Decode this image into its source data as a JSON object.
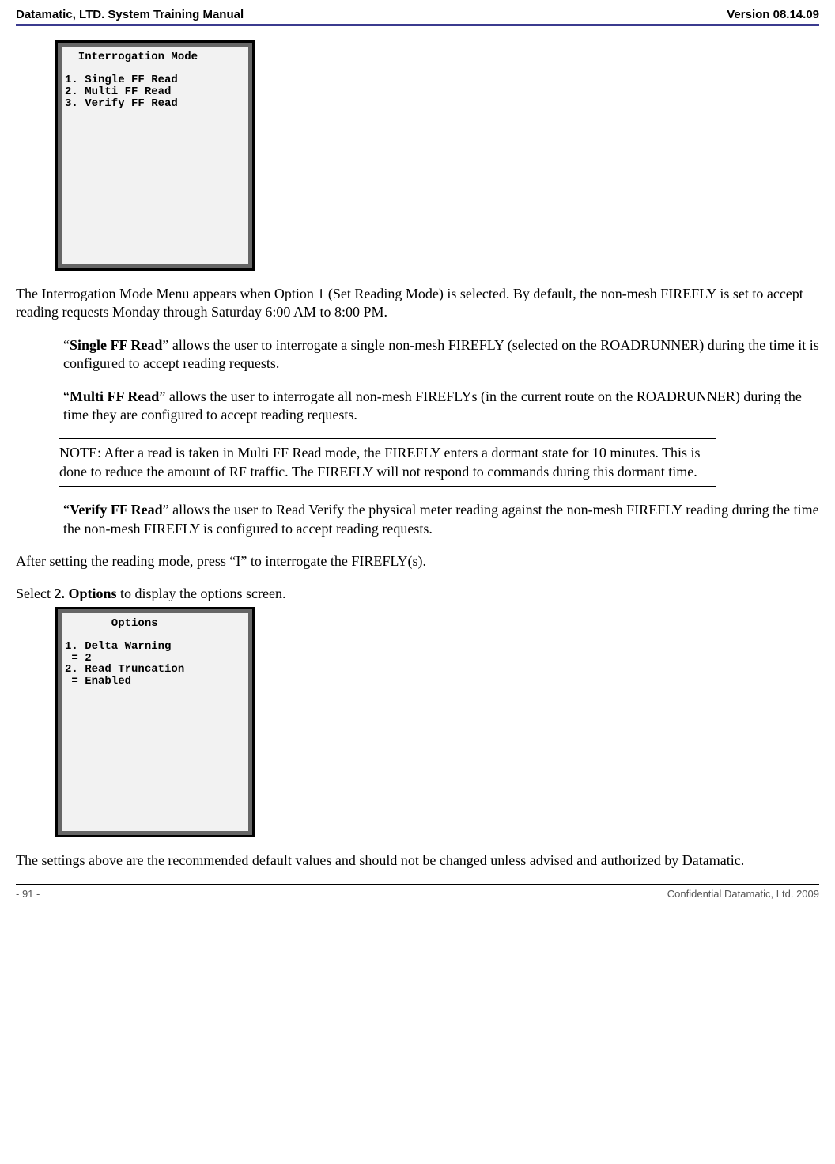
{
  "header": {
    "left": "Datamatic, LTD. System Training  Manual",
    "right": "Version 08.14.09"
  },
  "screen1": {
    "title": "  Interrogation Mode",
    "line1": "1. Single FF Read",
    "line2": "2. Multi FF Read",
    "line3": "3. Verify FF Read"
  },
  "para1_a": "The Interrogation Mode Menu appears when Option 1 (Set Reading Mode) is selected.  By default, the non-mesh FIREFLY is set to accept reading requests Monday through Saturday 6:00 AM to 8:00 PM.",
  "single_bold": "Single FF Read",
  "single_rest": "” allows the user to interrogate a single non-mesh FIREFLY (selected on the ROADRUNNER) during the time it is configured to accept reading requests.",
  "multi_bold": "Multi FF Read",
  "multi_rest": "” allows the user to interrogate all non-mesh FIREFLYs (in the current route on the ROADRUNNER) during the time they are configured to accept reading requests.",
  "note": "NOTE: After a read is taken in Multi FF Read mode, the FIREFLY enters a dormant state for 10 minutes.  This is done to reduce the amount of RF traffic.  The FIREFLY will not respond to commands during this dormant time.",
  "verify_bold": "Verify FF Read",
  "verify_rest": "” allows the user to Read Verify the physical meter reading against the non-mesh FIREFLY reading during the time the non-mesh FIREFLY is configured to accept reading requests.",
  "after_para": "After setting the reading mode, press “I” to interrogate the FIREFLY(s).",
  "select_pre": "Select ",
  "select_bold": "2. Options",
  "select_post": " to display the options screen.",
  "screen2": {
    "title": "       Options",
    "line1": "1. Delta Warning",
    "line2": " = 2",
    "line3": "2. Read Truncation",
    "line4": " = Enabled"
  },
  "settings_para": "The settings above are the recommended default values and should not be changed unless advised and authorized by Datamatic.",
  "footer": {
    "left": "- 91 -",
    "right": "Confidential Datamatic, Ltd. 2009"
  }
}
